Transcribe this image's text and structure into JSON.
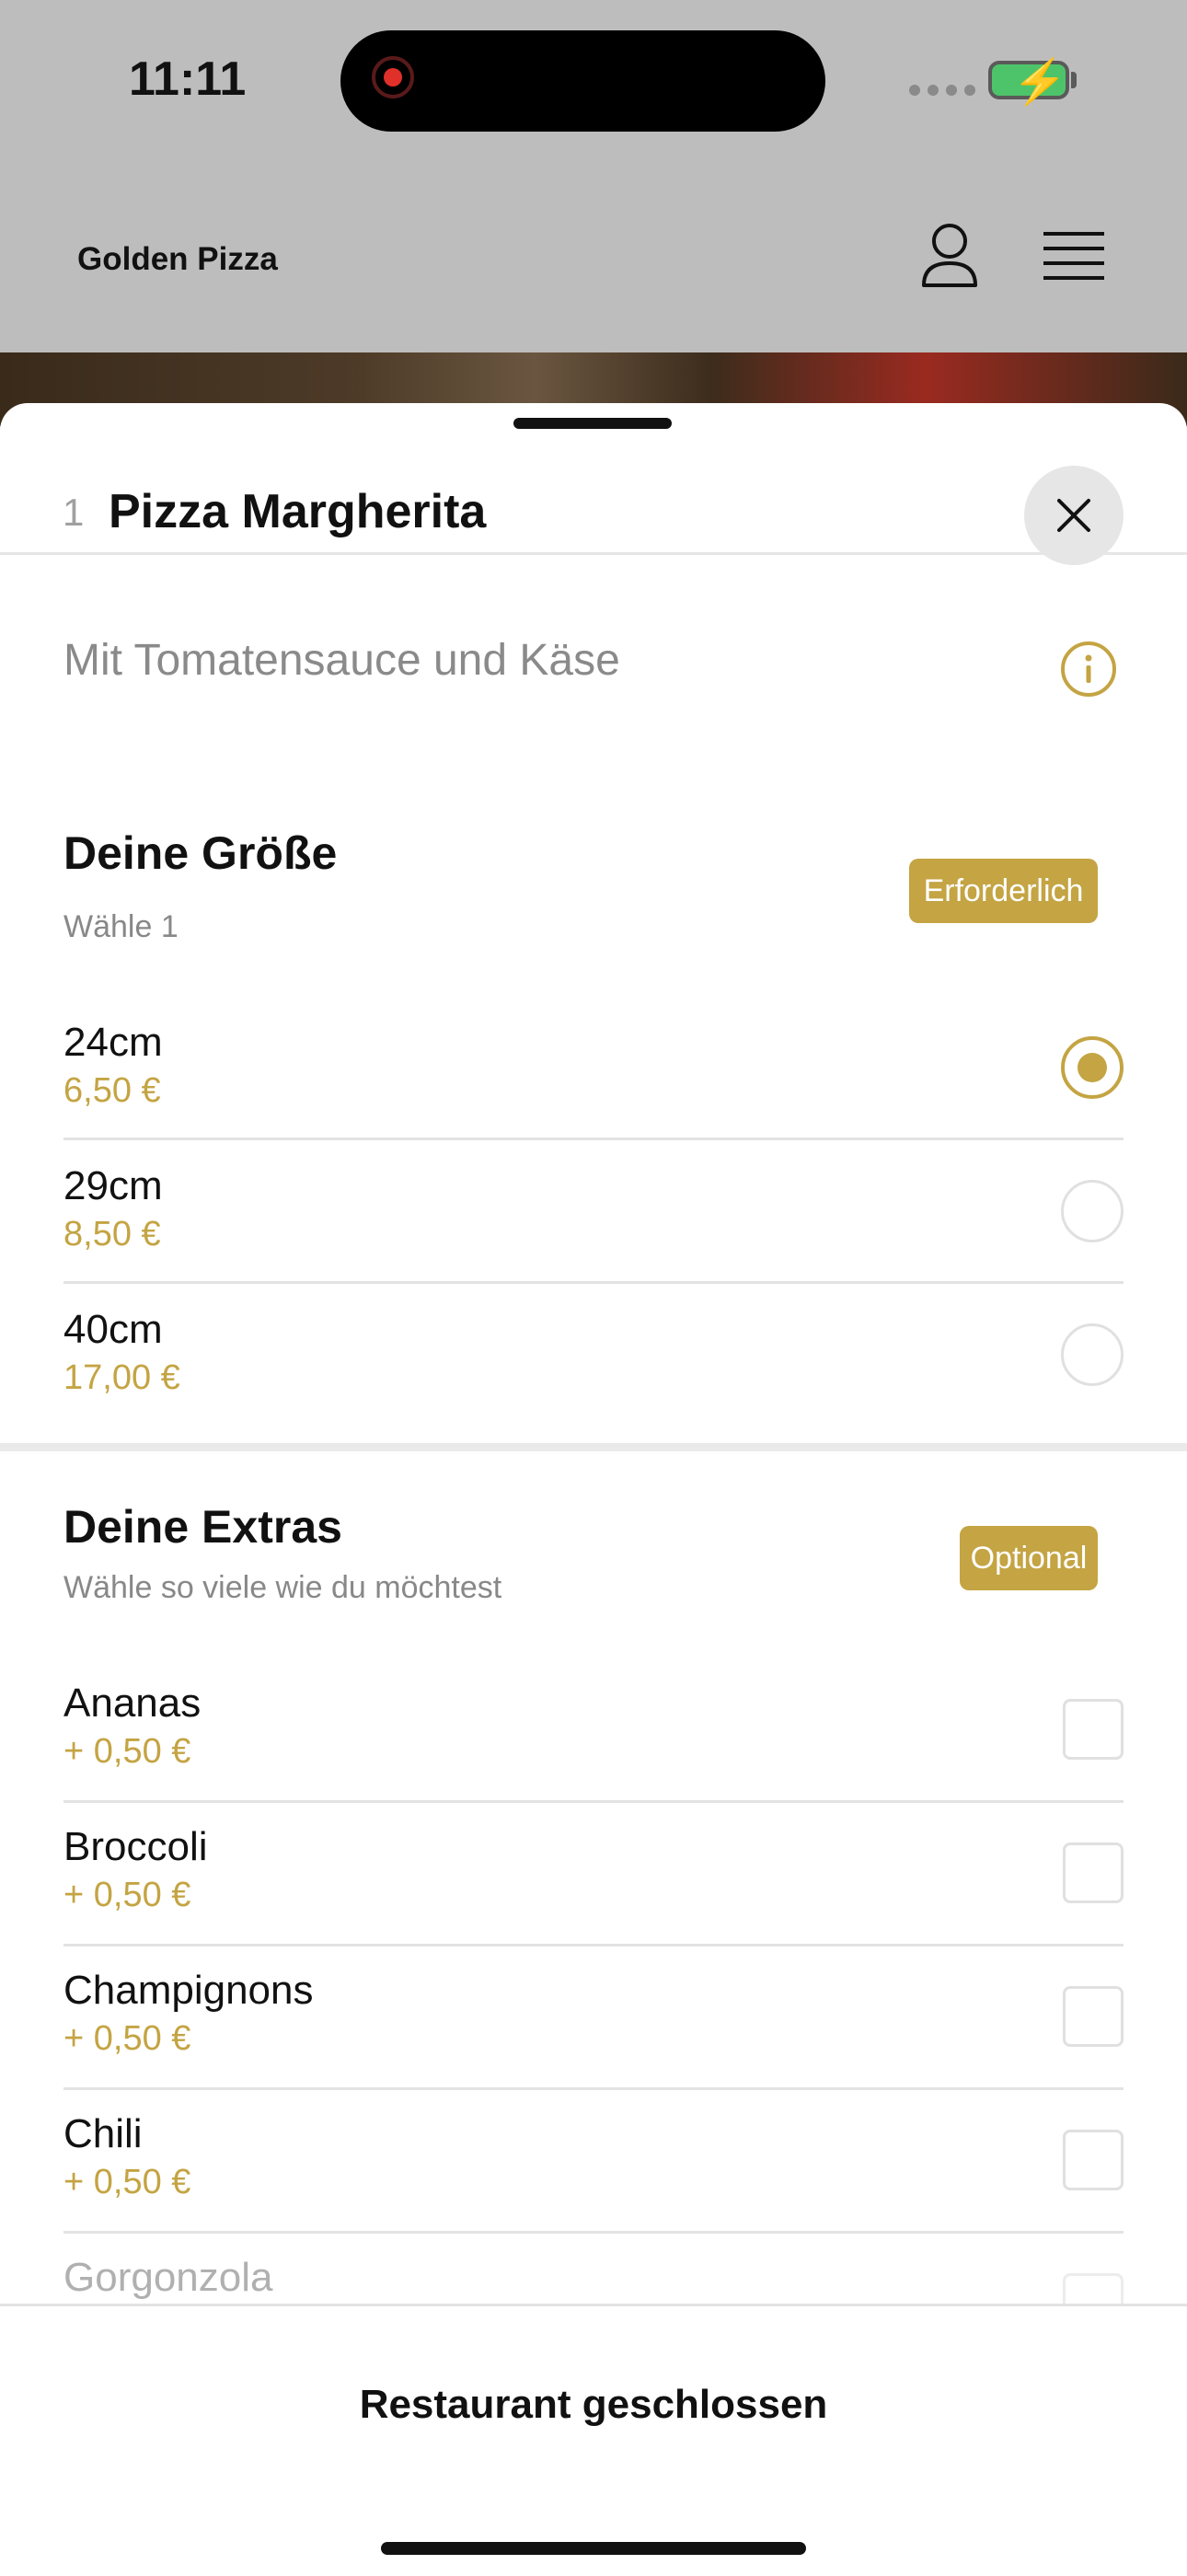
{
  "status_bar": {
    "time": "11:11"
  },
  "header": {
    "brand": "Golden Pizza"
  },
  "sheet": {
    "quantity": "1",
    "title": "Pizza Margherita",
    "description": "Mit Tomatensauce und Käse"
  },
  "size_section": {
    "title": "Deine Größe",
    "subtitle": "Wähle 1",
    "badge": "Erforderlich",
    "options": [
      {
        "name": "24cm",
        "price": "6,50 €",
        "selected": true
      },
      {
        "name": "29cm",
        "price": "8,50 €",
        "selected": false
      },
      {
        "name": "40cm",
        "price": "17,00 €",
        "selected": false
      }
    ]
  },
  "extras_section": {
    "title": "Deine Extras",
    "subtitle": "Wähle so viele wie du möchtest",
    "badge": "Optional",
    "options": [
      {
        "name": "Ananas",
        "price": "+ 0,50 €"
      },
      {
        "name": "Broccoli",
        "price": "+ 0,50 €"
      },
      {
        "name": "Champignons",
        "price": "+ 0,50 €"
      },
      {
        "name": "Chili",
        "price": "+ 0,50 €"
      },
      {
        "name": "Gorgonzola",
        "price": ""
      }
    ]
  },
  "footer": {
    "status": "Restaurant geschlossen"
  },
  "colors": {
    "accent": "#c4a443",
    "overlay": "#bdbdbd"
  }
}
